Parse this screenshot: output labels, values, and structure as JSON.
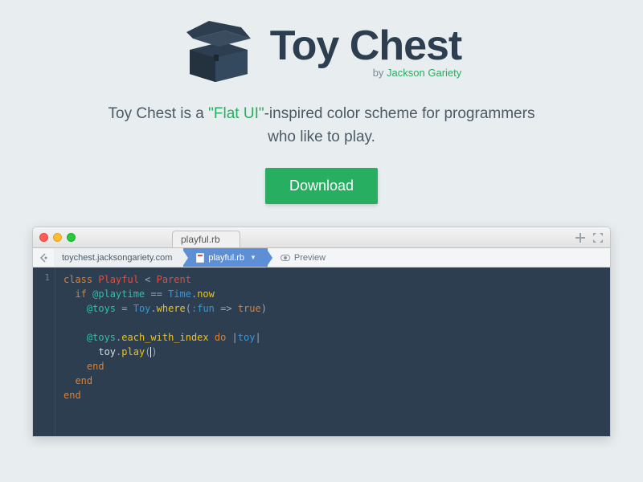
{
  "header": {
    "title": "Toy Chest",
    "byline_prefix": "by ",
    "author": "Jackson Gariety"
  },
  "tagline": {
    "pre": "Toy Chest is a ",
    "highlight": "\"Flat UI\"",
    "post": "-inspired color scheme for programmers who like to play."
  },
  "download_label": "Download",
  "editor": {
    "file_tab": "playful.rb",
    "breadcrumbs": {
      "domain": "toychest.jacksongariety.com",
      "file": "playful.rb",
      "preview": "Preview"
    },
    "gutter_line": "1",
    "code": {
      "l1": {
        "kw": "class",
        "cls": " Playful",
        "op": " < ",
        "parent": "Parent"
      },
      "l2": {
        "kw": "if",
        "ivar": " @playtime",
        "op": " == ",
        "const": "Time",
        "dot": ".",
        "method": "now"
      },
      "l3": {
        "ivar": "@toys",
        "op": " = ",
        "const": "Toy",
        "dot": ".",
        "method": "where",
        "popen": "(",
        "sym": ":fun",
        "arrow": " => ",
        "bool": "true",
        "pclose": ")"
      },
      "l5": {
        "ivar": "@toys",
        "dot": ".",
        "method": "each_with_index",
        "kw": " do ",
        "pipe1": "|",
        "arg": "toy",
        "pipe2": "|"
      },
      "l6": {
        "var": "toy",
        "dot": ".",
        "method": "play",
        "popen": "(",
        "pclose": ")"
      },
      "l7": {
        "kw": "end"
      },
      "l8": {
        "kw": "end"
      },
      "l9": {
        "kw": "end"
      }
    }
  }
}
